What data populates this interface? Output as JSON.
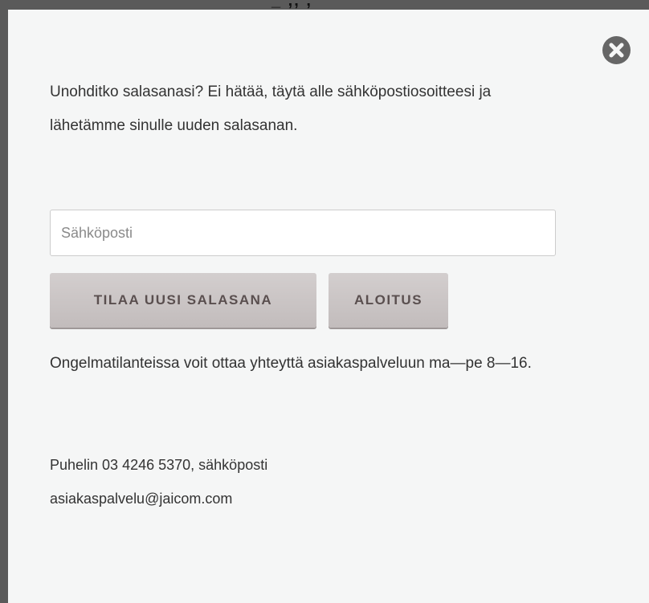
{
  "modal": {
    "intro_text": "Unohditko salasanasi? Ei hätää, täytä alle sähköpostiosoitteesi ja lähetämme sinulle uuden salasanan.",
    "email_placeholder": "Sähköposti",
    "order_button_label": "TILAA UUSI SALASANA",
    "start_button_label": "ALOITUS",
    "help_text": "Ongelmatilanteissa voit ottaa yhteyttä asiakaspalveluun ma—pe 8—16.",
    "contact_text": "Puhelin 03 4246 5370, sähköposti",
    "contact_email": "asiakaspalvelu@jaicom.com",
    "close_icon": "close-circle-icon"
  },
  "colors": {
    "overlay": "#5a5a5a",
    "modal_background": "#f5f6f6",
    "button_background": "#c9c3c3",
    "button_text": "#5a4f4f",
    "body_text": "#333333"
  }
}
